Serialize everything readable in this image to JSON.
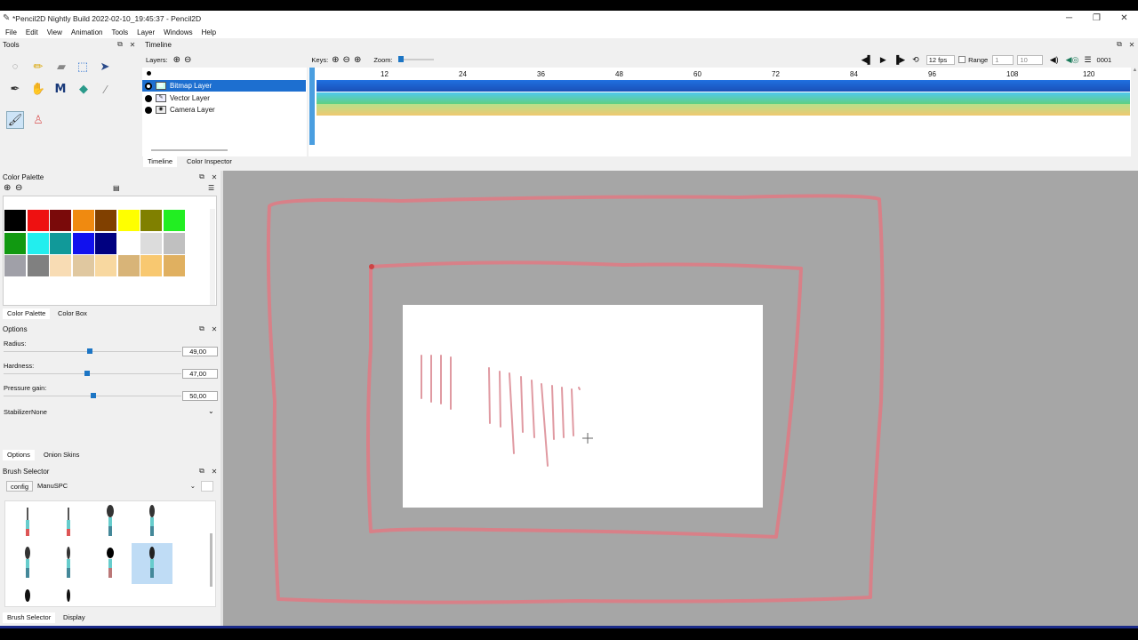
{
  "window": {
    "title": "*Pencil2D Nightly Build 2022-02-10_19:45:37 - Pencil2D",
    "minimize": "─",
    "maximize": "❐",
    "close": "✕"
  },
  "menu": [
    "File",
    "Edit",
    "View",
    "Animation",
    "Tools",
    "Layer",
    "Windows",
    "Help"
  ],
  "tools_panel": {
    "title": "Tools"
  },
  "timeline": {
    "title": "Timeline",
    "layers_label": "Layers:",
    "keys_label": "Keys:",
    "zoom_label": "Zoom:",
    "fps": "12 fps",
    "range_label": "Range",
    "range_start": "1",
    "range_end": "10",
    "frame_counter": "0001",
    "ruler": [
      "12",
      "24",
      "36",
      "48",
      "60",
      "72",
      "84",
      "96",
      "108",
      "120"
    ],
    "layers": [
      {
        "name": "Bitmap Layer",
        "selected": true,
        "color": "#1d5fd0"
      },
      {
        "name": "Vector Layer",
        "selected": false,
        "color": "#55c98c"
      },
      {
        "name": "Camera Layer",
        "selected": false,
        "color": "#f0c87a"
      }
    ],
    "tabs": [
      "Timeline",
      "Color Inspector"
    ]
  },
  "color_palette": {
    "title": "Color Palette",
    "swatches": [
      "#000000",
      "#ee1111",
      "#7a0a0a",
      "#f08a10",
      "#804000",
      "#ffff00",
      "#808000",
      "#22ee22",
      "#119911",
      "#22eeee",
      "#119999",
      "#1111ee",
      "#000080",
      "#ffffff",
      "#dcdcdc",
      "#c0c0c0",
      "#a0a0a8",
      "#808080",
      "#f8dcb4",
      "#e0c8a0",
      "#f8d8a0",
      "#d8b478",
      "#f8c870",
      "#e0b060"
    ],
    "tabs": [
      "Color Palette",
      "Color Box"
    ]
  },
  "options": {
    "title": "Options",
    "radius_label": "Radius:",
    "radius_value": "49,00",
    "hardness_label": "Hardness:",
    "hardness_value": "47,00",
    "pressure_label": "Pressure gain:",
    "pressure_value": "50,00",
    "stabilizer_label": "Stabilizer",
    "stabilizer_value": "None",
    "tabs": [
      "Options",
      "Onion Skins"
    ]
  },
  "brush_selector": {
    "title": "Brush Selector",
    "config_button": "config",
    "preset": "ManuSPC",
    "tabs": [
      "Brush Selector",
      "Display"
    ]
  },
  "colors": {
    "accent": "#1c75c4",
    "canvas_bg": "#a6a6a6",
    "stroke": "#d88088"
  }
}
